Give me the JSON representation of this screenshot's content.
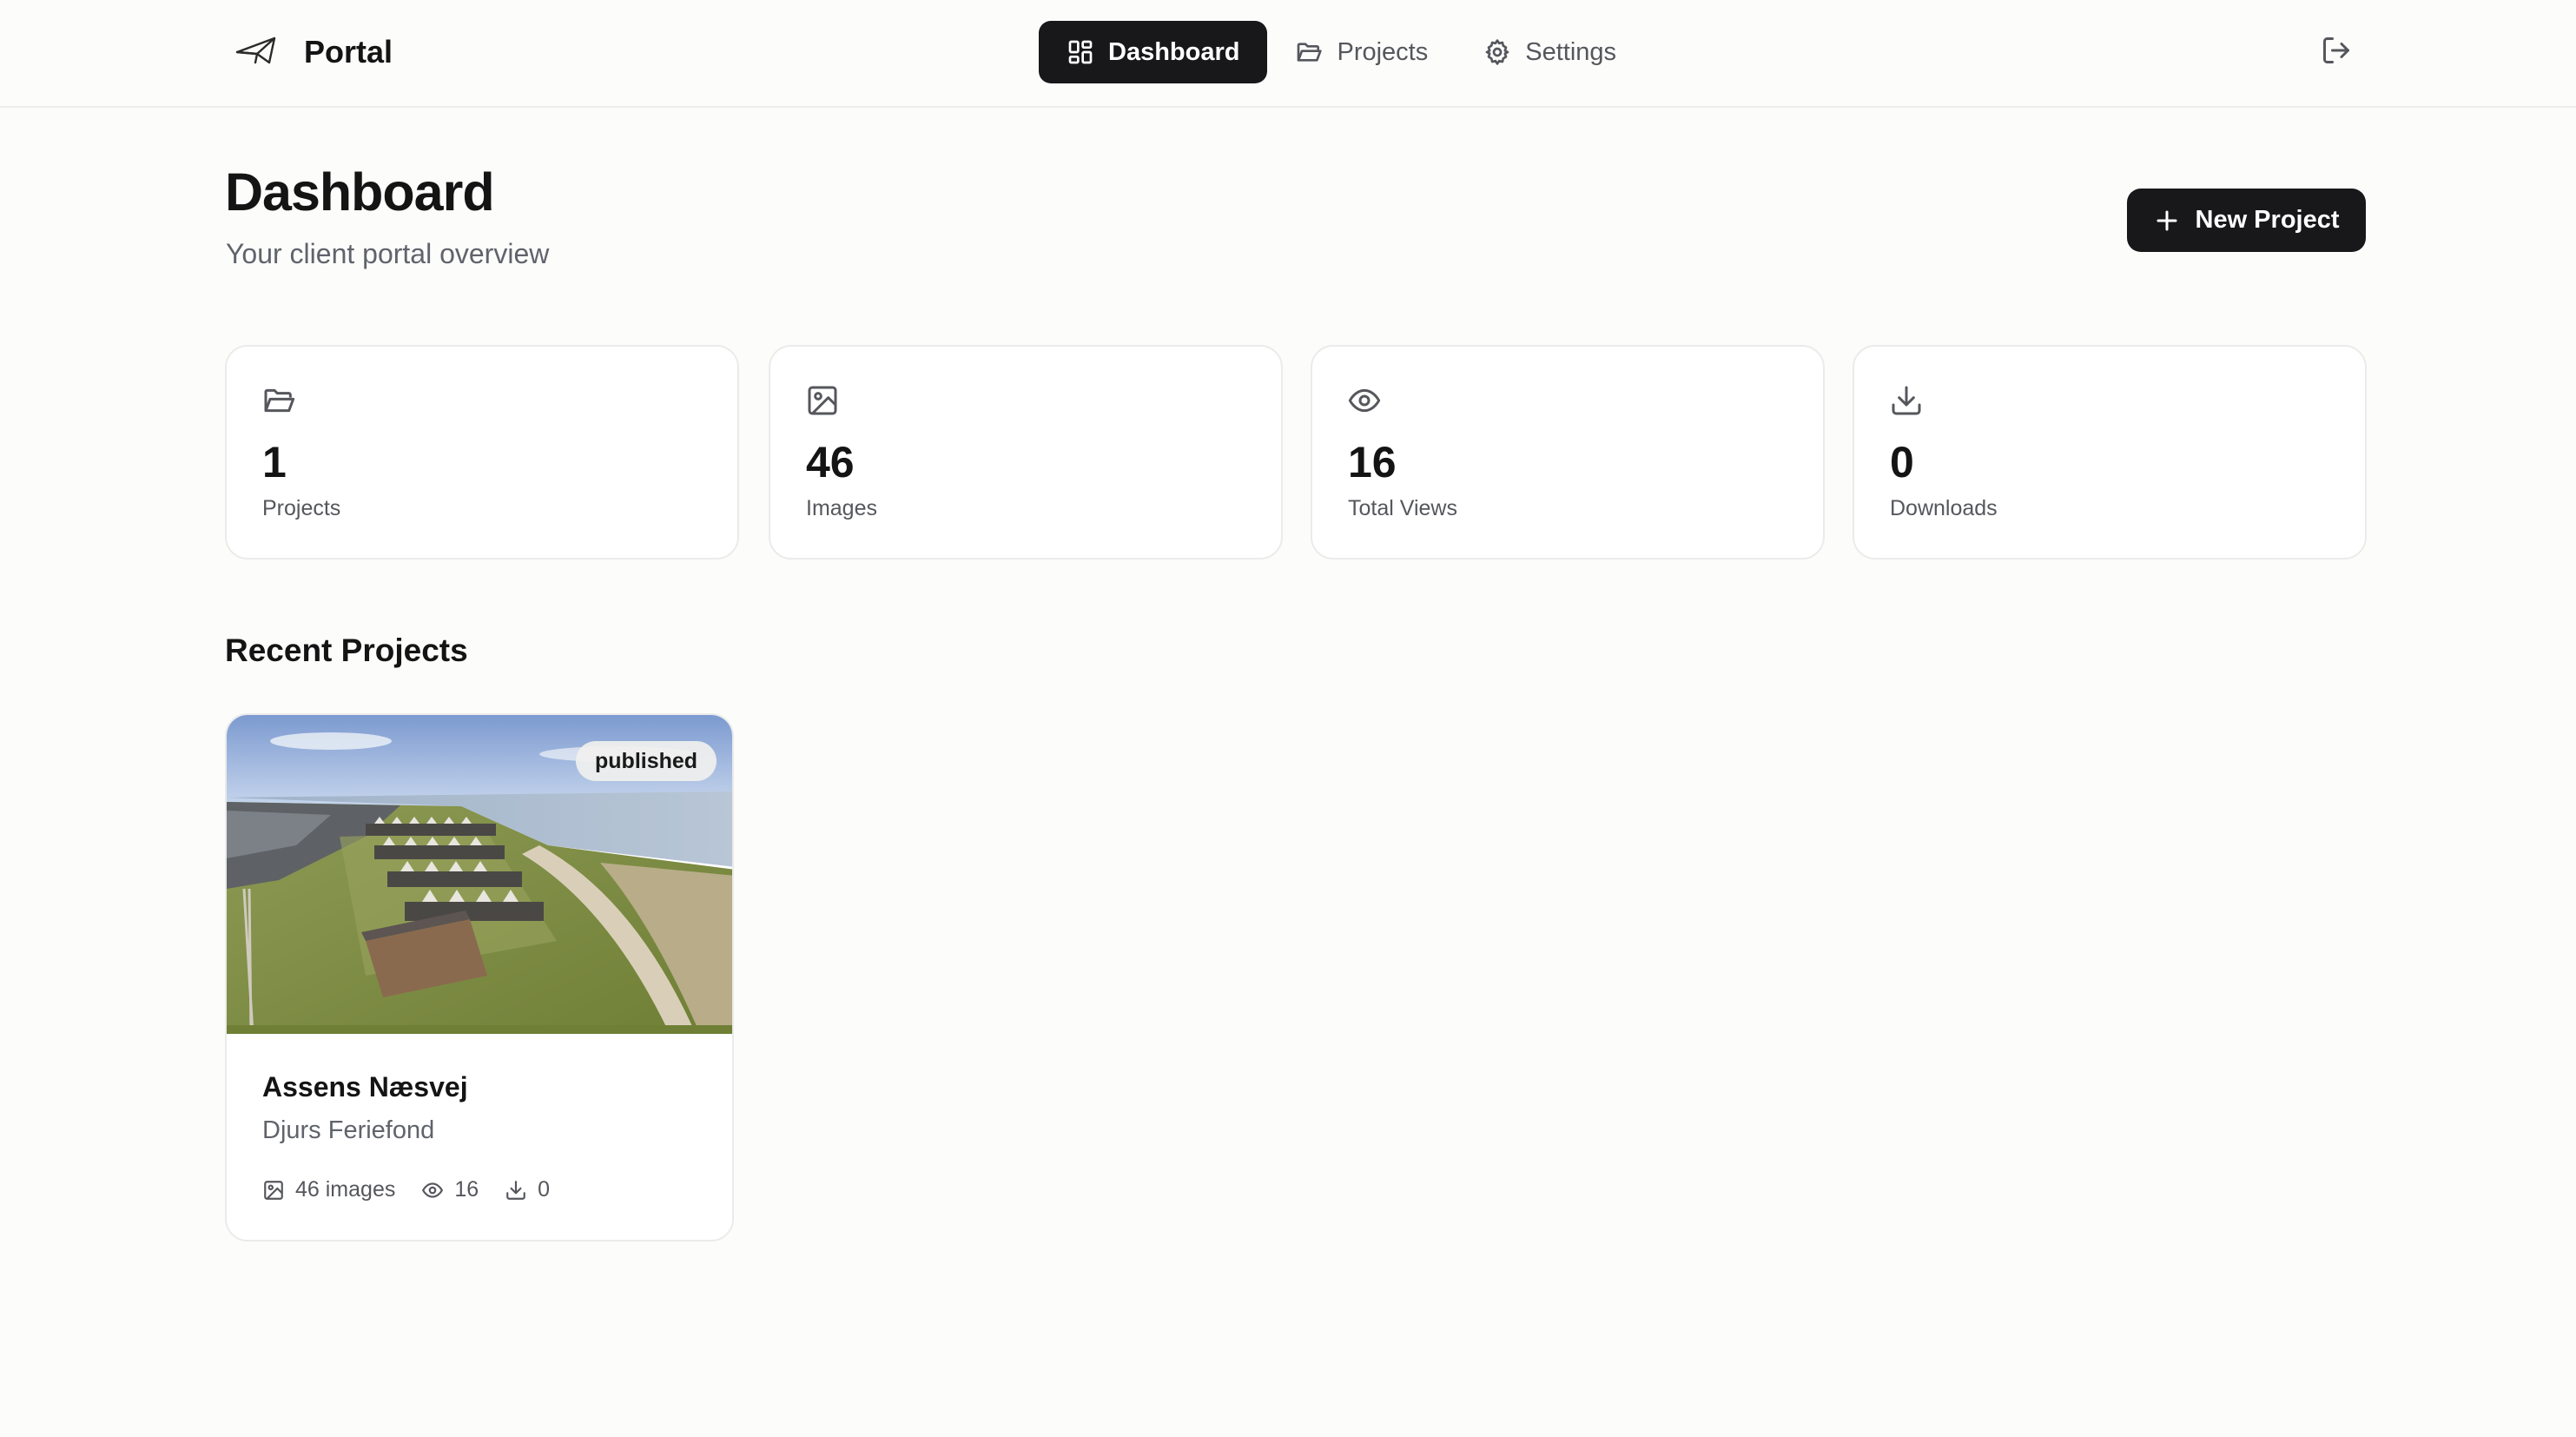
{
  "brand": {
    "name": "Portal"
  },
  "nav": {
    "items": [
      {
        "label": "Dashboard",
        "icon": "grid-icon",
        "active": true
      },
      {
        "label": "Projects",
        "icon": "folder-icon",
        "active": false
      },
      {
        "label": "Settings",
        "icon": "gear-icon",
        "active": false
      }
    ],
    "logout_icon": "logout-icon"
  },
  "header": {
    "title": "Dashboard",
    "subtitle": "Your client portal overview",
    "new_project_label": "New Project"
  },
  "stats": [
    {
      "value": "1",
      "label": "Projects",
      "icon": "folder-icon"
    },
    {
      "value": "46",
      "label": "Images",
      "icon": "image-icon"
    },
    {
      "value": "16",
      "label": "Total Views",
      "icon": "eye-icon"
    },
    {
      "value": "0",
      "label": "Downloads",
      "icon": "download-icon"
    }
  ],
  "recent": {
    "title": "Recent Projects",
    "projects": [
      {
        "status": "published",
        "name": "Assens Næsvej",
        "client": "Djurs Feriefond",
        "images": "46 images",
        "views": "16",
        "downloads": "0"
      }
    ]
  },
  "colors": {
    "background": "#fcfcfb",
    "primary": "#18181b",
    "muted_text": "#60636b",
    "border": "#ebebea"
  }
}
